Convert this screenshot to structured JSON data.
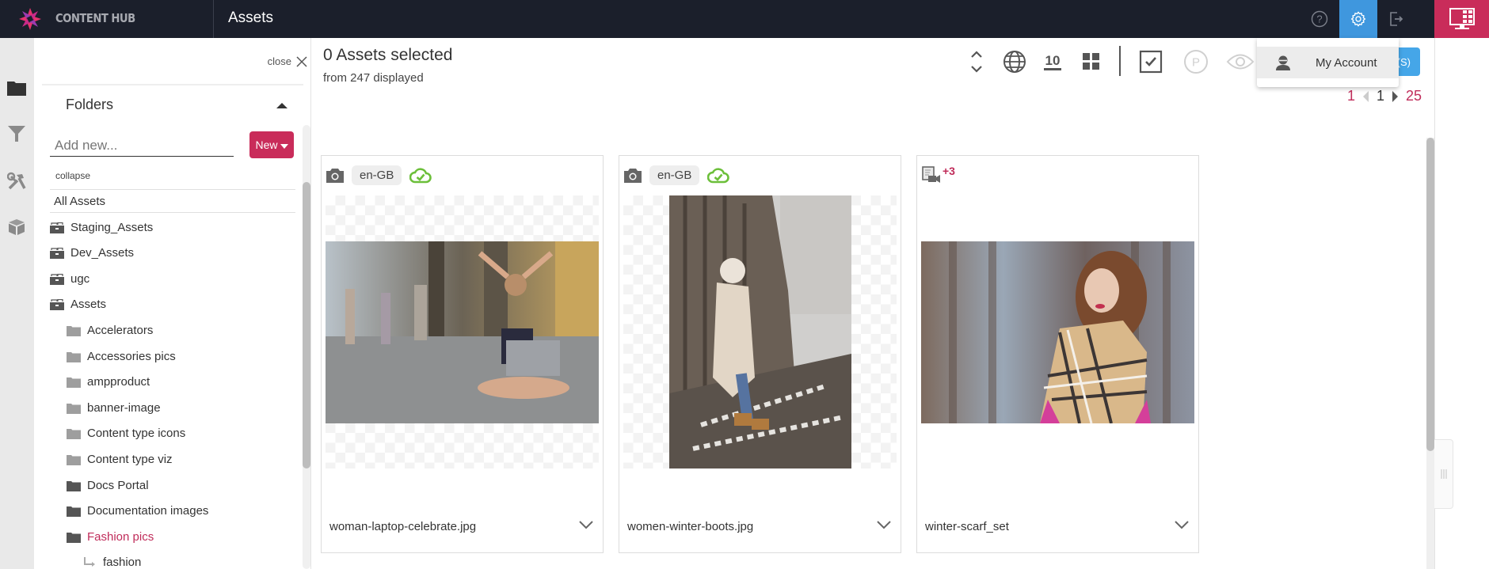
{
  "app": {
    "brand_name": "CONTENT HUB",
    "page_title": "Assets",
    "colors": {
      "topbar": "#1b1f2b",
      "accent": "#c92c5a",
      "active_blue": "#3f97de",
      "action_blue": "#45a6e8",
      "sync_green": "#6cbf3a"
    }
  },
  "topbar": {
    "icons": [
      "help-icon",
      "settings-icon",
      "logout-icon",
      "app-switcher-icon"
    ]
  },
  "account_menu": {
    "items": [
      {
        "label": "My Account",
        "icon": "user-icon"
      }
    ]
  },
  "rail": {
    "items": [
      {
        "name": "folders",
        "icon": "folder-icon",
        "active": true
      },
      {
        "name": "filters",
        "icon": "filter-icon",
        "active": false
      },
      {
        "name": "tools",
        "icon": "tools-icon",
        "active": false
      },
      {
        "name": "packages",
        "icon": "box-icon",
        "active": false
      }
    ]
  },
  "panel": {
    "close_label": "close",
    "folders_title": "Folders",
    "add_new_placeholder": "Add new...",
    "add_new_value": "",
    "new_button_label": "New",
    "collapse_label": "collapse",
    "all_assets_label": "All Assets",
    "repositories": [
      {
        "label": "Staging_Assets"
      },
      {
        "label": "Dev_Assets"
      },
      {
        "label": "ugc"
      },
      {
        "label": "Assets"
      }
    ],
    "folders": [
      {
        "label": "Accelerators",
        "shade": "light"
      },
      {
        "label": "Accessories pics",
        "shade": "light"
      },
      {
        "label": "ampproduct",
        "shade": "light"
      },
      {
        "label": "banner-image",
        "shade": "light"
      },
      {
        "label": "Content type icons",
        "shade": "light"
      },
      {
        "label": "Content type viz",
        "shade": "light"
      },
      {
        "label": "Docs Portal",
        "shade": "dark"
      },
      {
        "label": "Documentation images",
        "shade": "dark"
      },
      {
        "label": "Fashion pics",
        "shade": "dark",
        "active": true
      }
    ],
    "subfolders": [
      {
        "label": "fashion"
      }
    ]
  },
  "main": {
    "selected_title": "0 Assets selected",
    "selected_sub": "from 247 displayed",
    "page_size": "10",
    "action_button_label": "T(S)",
    "pager": {
      "first": "1",
      "current": "1",
      "last": "25"
    },
    "cards": [
      {
        "type_icon": "camera-icon",
        "locale": "en-GB",
        "status_icon": "cloud-check-icon",
        "name": "woman-laptop-celebrate.jpg",
        "orientation": "landscape"
      },
      {
        "type_icon": "camera-icon",
        "locale": "en-GB",
        "status_icon": "cloud-check-icon",
        "name": "women-winter-boots.jpg",
        "orientation": "portrait"
      },
      {
        "type_icon": "media-set-icon",
        "set_badge": "+3",
        "name": "winter-scarf_set",
        "orientation": "landscape"
      }
    ]
  }
}
